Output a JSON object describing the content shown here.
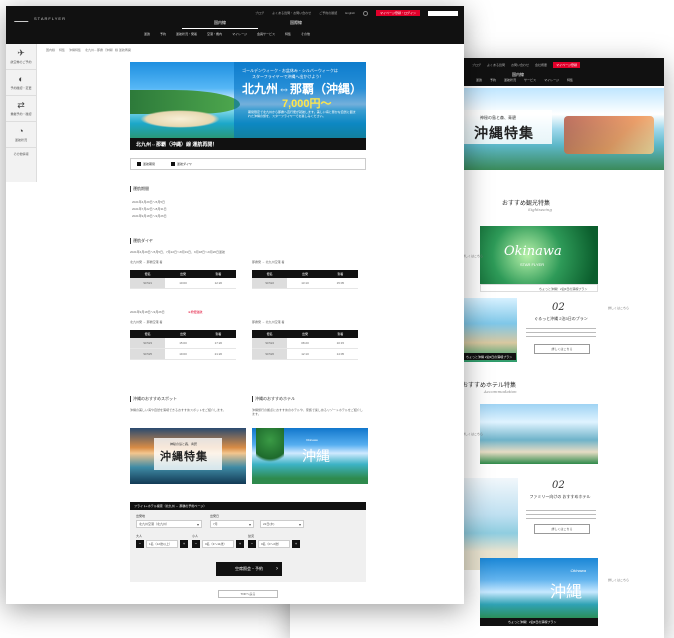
{
  "back": {
    "links": [
      "ブログ",
      "よくある質問",
      "お問い合わせ",
      "会社概要",
      "採用情報"
    ],
    "cta": "マイページ登録",
    "tab": "国内線",
    "nav": [
      "運賃",
      "予約",
      "運航状況",
      "サービス",
      "マイレージ",
      "特集"
    ],
    "hero_small": "神秘の島と森、青碧",
    "hero_title": "沖縄特集",
    "sightseeing_title": "おすすめ観光特集",
    "sightseeing_sub": "Sightseeing",
    "card1_title": "Okinawa",
    "card1_sub": "STAR FLYER",
    "card1_bar": "ちょっと沖縄！2泊3日の満喫プラン",
    "card2_num": "02",
    "card2_cap": "ぐるっと沖縄 2泊3日のプラン",
    "card2_btn": "詳しくはこちら",
    "card_beach_bar": "ちょっと沖縄 2泊3日の満喫プラン",
    "hotel_title": "おすすめホテル特集",
    "hotel_sub": "Accommodation",
    "card3_num": "02",
    "card3_cap": "ファミリー向けの おすすめホテル",
    "card3_btn": "詳しくはこちら",
    "card4_title": "沖縄",
    "card4_sub": "Okinawa",
    "side_notes": [
      "詳しくはこちら",
      "詳しくはこちら",
      "詳しくはこちら",
      "詳しくはこちら"
    ]
  },
  "front": {
    "logo": "STARFLYER",
    "util": [
      "ブログ",
      "よくある質問・お問い合わせ",
      "ご予約の確認",
      "English"
    ],
    "util_cta": "マイページ登録・ログイン",
    "tabs": [
      "国内線",
      "国際線"
    ],
    "nav": [
      "運賃",
      "予約",
      "運航状況・発着",
      "空港・機内",
      "マイレージ",
      "会員サービス",
      "特集",
      "その他"
    ],
    "sidebar": [
      {
        "glyph": "✈",
        "label": "航空券のご予約"
      },
      {
        "glyph": "◐",
        "label": "予約確認・変更"
      },
      {
        "glyph": "⇄",
        "label": "乗継予約・確認"
      },
      {
        "glyph": "◔",
        "label": "運航状況"
      },
      {
        "glyph": "",
        "label": "その他情報"
      }
    ],
    "crumbs": [
      "国内線",
      "特集",
      "沖縄特集",
      "北九州⇔那覇（沖縄）線 運航再開"
    ],
    "banner": {
      "line1": "ゴールデンウィーク・お盆休み・シルバーウィークは",
      "line2": "スターフライヤーで沖縄へ出かけよう！",
      "title": "北九州⇔那覇（沖縄）",
      "price": "7,000円〜",
      "desc": "期間限定で北九州から那覇へ直行便が就航します。美しい海と豊かな自然に囲まれた沖縄の旅を、スターフライヤーでお楽しみください。",
      "strip": "北九州⇔那覇（沖縄）線 運航再開！"
    },
    "tabbar": [
      "運航期間",
      "運航ダイヤ"
    ],
    "period_title": "運航期間",
    "periods": [
      "2021年4月29日〜5月5日",
      "2021年7月22日〜8月31日",
      "2021年9月18日〜9月26日"
    ],
    "schedule_title": "運航ダイヤ",
    "schedule_note": "2021年4月29日〜5月5日、7月22日〜8月31日、9月18日〜9月26日運航",
    "route_a": "北九州発 → 那覇空港 着",
    "route_b": "那覇発 → 北九州空港 着",
    "table_head": [
      "便名",
      "出発",
      "到着"
    ],
    "table_rows1": [
      [
        "SF521",
        "10:00",
        "12:20"
      ]
    ],
    "table_rows2": [
      [
        "SF522",
        "13:10",
        "15:05"
      ]
    ],
    "schedule2_note": "2021年9月18日〜9月26日",
    "schedule2_red": "※増便運航",
    "table_rows3": [
      [
        "SF523",
        "15:00",
        "17:20"
      ],
      [
        "SF525",
        "19:00",
        "21:20"
      ]
    ],
    "table_rows4": [
      [
        "SF524",
        "08:20",
        "10:15"
      ],
      [
        "SF526",
        "12:10",
        "14:05"
      ]
    ],
    "spot_title": "沖縄のおすすめスポット",
    "spot_desc": "沖縄の美しい海や自然を満喫できるおすすめスポットをご紹介します。",
    "hotel_title": "沖縄のおすすめホテル",
    "hotel_desc": "沖縄旅行の拠点におすすめのホテルや、家族で楽しめるリゾートホテルをご紹介します。",
    "spot_small": "神秘の島と森、青碧",
    "spot_big": "沖縄特集",
    "hotel_big": "沖縄",
    "hotel_small": "Okinawa",
    "panel_title": "フライト+ホテル検索（北九州 ⇔ 那覇の予約ページ）",
    "panel_labels": [
      "出発地",
      "出発日",
      "大人",
      "小人",
      "幼児"
    ],
    "panel_from": "北九州空港（北九州）",
    "panel_date1": "7月",
    "panel_date2": "22日(木)",
    "panel_adult": "1名（12歳以上）",
    "panel_child": "0名（3〜11歳）",
    "panel_infant": "0名（0〜2歳）",
    "panel_go": "空席照会・予約",
    "pager": "TOPへ戻る"
  }
}
